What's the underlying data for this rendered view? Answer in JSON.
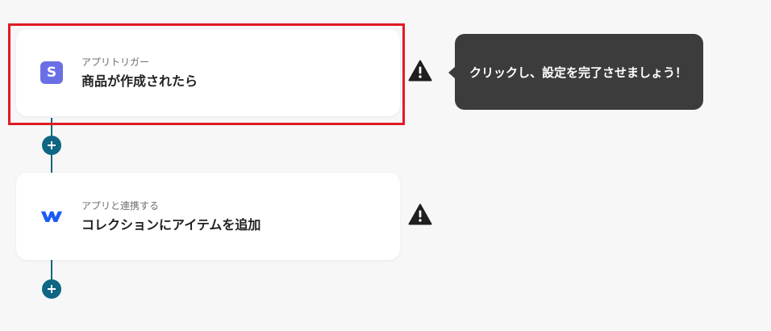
{
  "flow": {
    "steps": [
      {
        "subtitle": "アプリトリガー",
        "title": "商品が作成されたら",
        "app_icon": "stripe-icon",
        "app_icon_letter": "S",
        "app_icon_color": "#6b6fe6",
        "warning": true
      },
      {
        "subtitle": "アプリと連携する",
        "title": "コレクションにアイテムを追加",
        "app_icon": "webflow-icon",
        "app_icon_color": "#1a5cf5",
        "warning": true
      }
    ],
    "connector_color": "#0e6683",
    "add_button_icon": "plus-icon"
  },
  "tooltip": {
    "text": "クリックし、設定を完了させましょう！"
  },
  "highlight": {
    "color": "#e01b24"
  },
  "warning_icon": "warning-triangle-icon"
}
